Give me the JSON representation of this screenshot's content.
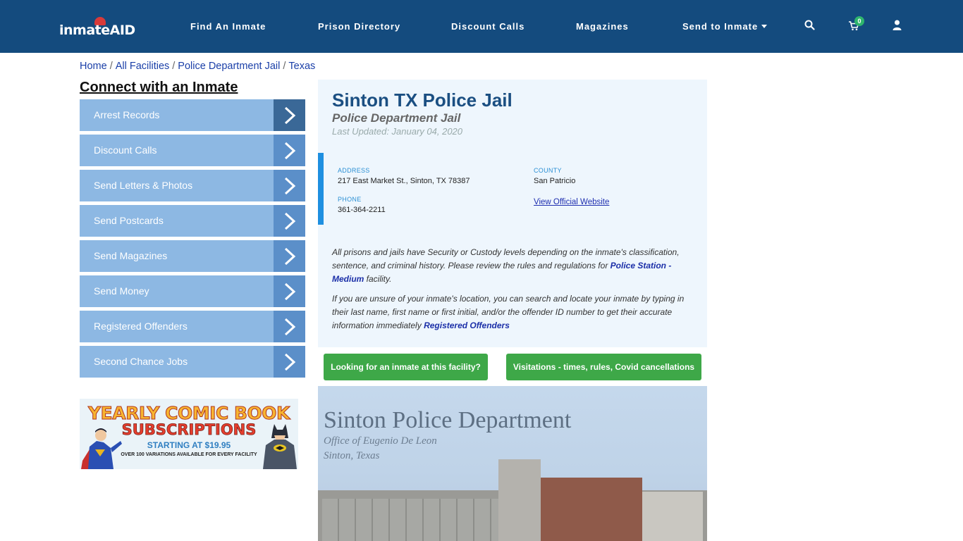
{
  "header": {
    "logo_text": "inmateAID",
    "nav": [
      "Find An Inmate",
      "Prison Directory",
      "Discount Calls",
      "Magazines",
      "Send to Inmate"
    ],
    "cart_count": "0"
  },
  "breadcrumb": [
    "Home",
    "All Facilities",
    "Police Department Jail",
    "Texas"
  ],
  "sidebar": {
    "heading": "Connect with an Inmate",
    "items": [
      "Arrest Records",
      "Discount Calls",
      "Send Letters & Photos",
      "Send Postcards",
      "Send Magazines",
      "Send Money",
      "Registered Offenders",
      "Second Chance Jobs"
    ]
  },
  "promo": {
    "line1": "YEARLY COMIC BOOK",
    "line2": "SUBSCRIPTIONS",
    "line3": "STARTING AT $19.95",
    "line4": "OVER 100 VARIATIONS AVAILABLE FOR EVERY FACILITY"
  },
  "facility": {
    "title": "Sinton TX Police Jail",
    "type": "Police Department Jail",
    "updated": "Last Updated: January 04, 2020",
    "address_label": "ADDRESS",
    "address": "217 East Market St., Sinton, TX 78387",
    "county_label": "COUNTY",
    "county": "San Patricio",
    "phone_label": "PHONE",
    "phone": "361-364-2211",
    "website_link": "View Official Website",
    "para1_text": "All prisons and jails have Security or Custody levels depending on the inmate's classification, sentence, and criminal history. Please review the rules and regulations for ",
    "para1_link": "Police Station - Medium",
    "para1_end": " facility.",
    "para2_text": "If you are unsure of your inmate's location, you can search and locate your inmate by typing in their last name, first name or first initial, and/or the offender ID number to get their accurate information immediately ",
    "para2_link": "Registered Offenders"
  },
  "buttons": {
    "looking": "Looking for an inmate at this facility?",
    "visitations": "Visitations - times, rules, Covid cancellations"
  },
  "photo": {
    "line1": "Sinton Police Department",
    "line2": "Office of Eugenio De Leon",
    "line3": "Sinton, Texas"
  }
}
